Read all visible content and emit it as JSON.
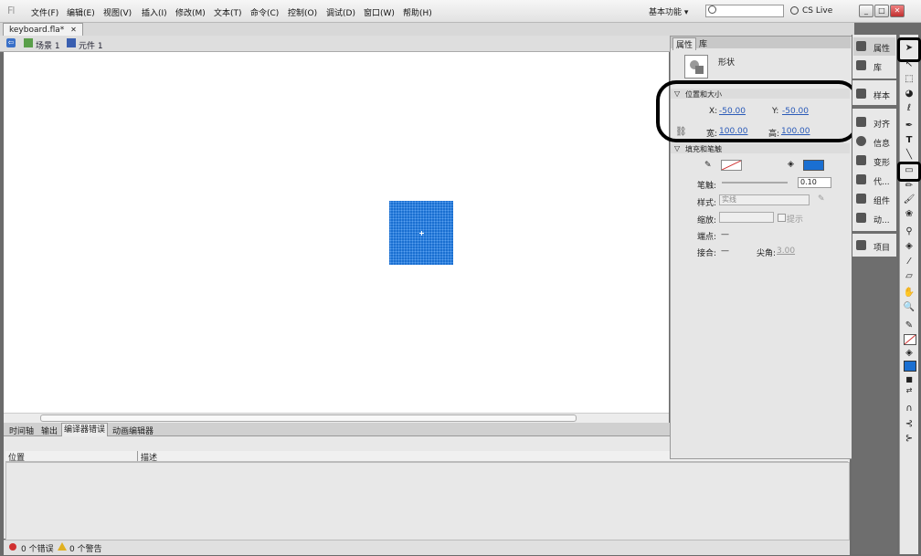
{
  "app": {
    "logo": "Fl"
  },
  "menu": [
    "文件(F)",
    "编辑(E)",
    "视图(V)",
    "插入(I)",
    "修改(M)",
    "文本(T)",
    "命令(C)",
    "控制(O)",
    "调试(D)",
    "窗口(W)",
    "帮助(H)"
  ],
  "topbar": {
    "workspace": "基本功能 ▾",
    "search_placeholder": "",
    "cs_live": "CS Live"
  },
  "document": {
    "tab": "keyboard.fla*",
    "tab_close": "✕"
  },
  "editbar": {
    "scene": "场景 1",
    "symbol": "元件 1"
  },
  "bottom_tabs": [
    "时间轴",
    "输出",
    "编译器错误",
    "动画编辑器"
  ],
  "errors": {
    "col_location": "位置",
    "col_description": "描述",
    "error_count": "0 个错误",
    "warning_count": "0 个警告"
  },
  "properties": {
    "tabs": [
      "属性",
      "库"
    ],
    "object_type": "形状",
    "section_position": "位置和大小",
    "x_label": "X:",
    "x_value": "-50.00",
    "y_label": "Y:",
    "y_value": "-50.00",
    "w_label": "宽:",
    "w_value": "100.00",
    "h_label": "高:",
    "h_value": "100.00",
    "section_fill": "填充和笔触",
    "stroke_label": "笔触:",
    "stroke_value": "0.10",
    "style_label": "样式:",
    "style_value": "实线",
    "scale_label": "缩放:",
    "hint_label": "提示",
    "cap_label": "端点:",
    "cap_value": "—",
    "join_label": "接合:",
    "join_value": "—",
    "miter_label": "尖角:",
    "miter_value": "3.00"
  },
  "dock": {
    "items": [
      "属性",
      "库",
      "样本",
      "对齐",
      "信息",
      "变形",
      "代...",
      "组件",
      "动...",
      "项目"
    ]
  },
  "colors": {
    "fill": "#1a6fd1",
    "stage": "#ffffff",
    "accent_link": "#2a5ab8"
  },
  "icons": [
    "select-tool",
    "subselect-tool",
    "free-transform-tool",
    "3d-rotation-tool",
    "lasso-tool",
    "pen-tool",
    "text-tool",
    "line-tool",
    "rectangle-tool",
    "pencil-tool",
    "brush-tool",
    "deco-tool",
    "bone-tool",
    "paint-bucket-tool",
    "eyedropper-tool",
    "eraser-tool",
    "hand-tool",
    "zoom-tool"
  ]
}
